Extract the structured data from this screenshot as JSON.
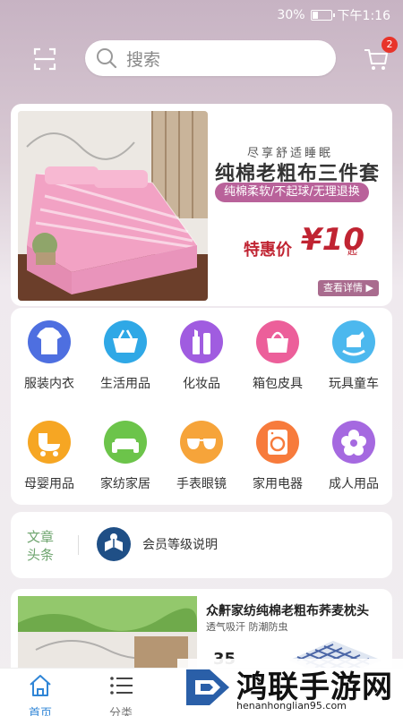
{
  "status_bar": {
    "battery_text": "30%",
    "time": "下午1:16",
    "battery_level": 0.3
  },
  "header": {
    "search_placeholder": "搜索",
    "cart_badge": "2"
  },
  "banner": {
    "subtitle": "尽享舒适睡眠",
    "title": "纯棉老粗布三件套",
    "pill": "纯棉柔软/不起球/无理退换",
    "price_label": "特惠价",
    "price": "¥10",
    "price_unit": "起",
    "detail_button": "查看详情 ▶"
  },
  "categories": [
    {
      "label": "服装内衣",
      "icon": "shirt-icon",
      "color": "#4e6fe0"
    },
    {
      "label": "生活用品",
      "icon": "basket-icon",
      "color": "#2fa8e6"
    },
    {
      "label": "化妆品",
      "icon": "cosmetics-icon",
      "color": "#a05ce0"
    },
    {
      "label": "箱包皮具",
      "icon": "handbag-icon",
      "color": "#ec5f9a"
    },
    {
      "label": "玩具童车",
      "icon": "rocking-horse-icon",
      "color": "#4cb8ee"
    },
    {
      "label": "母婴用品",
      "icon": "stroller-icon",
      "color": "#f6a623"
    },
    {
      "label": "家纺家居",
      "icon": "sofa-icon",
      "color": "#6cc44a"
    },
    {
      "label": "手表眼镜",
      "icon": "glasses-icon",
      "color": "#f6a43a"
    },
    {
      "label": "家用电器",
      "icon": "washing-machine-icon",
      "color": "#f77b3c"
    },
    {
      "label": "成人用品",
      "icon": "flower-icon",
      "color": "#a569e0"
    }
  ],
  "article": {
    "tag": "文章头条",
    "text": "会员等级说明"
  },
  "product": {
    "title": "众鼾家纺纯棉老粗布荞麦枕头",
    "subtitle": "透气吸汗 防潮防虫",
    "price": "35"
  },
  "bottom_nav": [
    {
      "label": "首页",
      "icon": "home-icon",
      "active": true
    },
    {
      "label": "分类",
      "icon": "list-icon",
      "active": false
    }
  ],
  "watermark": {
    "title": "鸿联手游网",
    "url": "henanhonglian95.com"
  },
  "colors": {
    "accent_blue": "#2f85d6",
    "price_red": "#c02432",
    "badge_red": "#e8342a"
  }
}
